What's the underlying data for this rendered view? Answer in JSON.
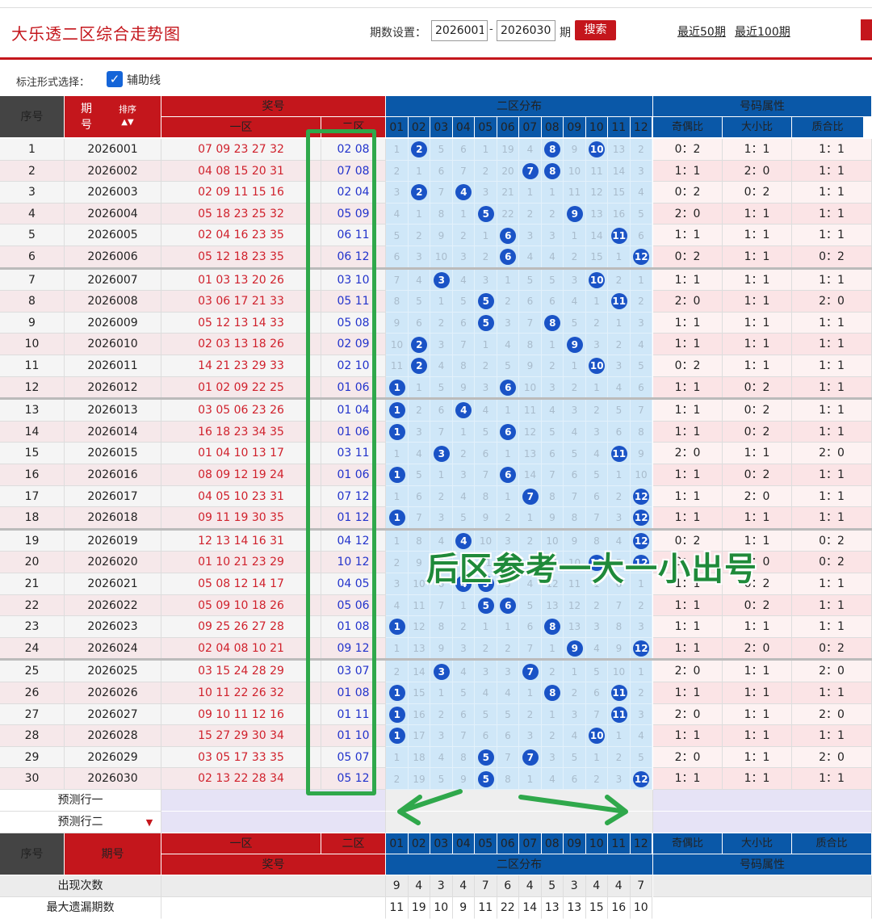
{
  "header": {
    "title": "大乐透二区综合走势图",
    "period_label": "期数设置：",
    "from_value": "2026001",
    "to_value": "2026030",
    "qi": "期",
    "search_label": "搜索",
    "recent50": "最近50期",
    "recent100": "最近100期"
  },
  "options": {
    "label": "标注形式选择：",
    "checkbox_label": "辅助线",
    "checked": true
  },
  "table_header": {
    "seq": "序号",
    "period": "期号",
    "sort": "排序",
    "prize": "奖号",
    "zone1": "一区",
    "zone2": "二区",
    "dist": "二区分布",
    "attr": "号码属性",
    "odd_even": "奇偶比",
    "big_small": "大小比",
    "prime": "质合比",
    "cols": [
      "01",
      "02",
      "03",
      "04",
      "05",
      "06",
      "07",
      "08",
      "09",
      "10",
      "11",
      "12"
    ]
  },
  "rows": [
    {
      "seq": "1",
      "period": "2026001",
      "front": "07 09 23 27 32",
      "back": "02 08",
      "dist": [
        "1",
        "02",
        "5",
        "6",
        "1",
        "19",
        "4",
        "08",
        "9",
        "10",
        "13",
        "2"
      ],
      "oe": "0：2",
      "bs": "1：1",
      "pc": "1：1"
    },
    {
      "seq": "2",
      "period": "2026002",
      "front": "04 08 15 20 31",
      "back": "07 08",
      "dist": [
        "2",
        "1",
        "6",
        "7",
        "2",
        "20",
        "07",
        "08",
        "10",
        "11",
        "14",
        "3"
      ],
      "oe": "1：1",
      "bs": "2：0",
      "pc": "1：1"
    },
    {
      "seq": "3",
      "period": "2026003",
      "front": "02 09 11 15 16",
      "back": "02 04",
      "dist": [
        "3",
        "02",
        "7",
        "04",
        "3",
        "21",
        "1",
        "1",
        "11",
        "12",
        "15",
        "4"
      ],
      "oe": "0：2",
      "bs": "0：2",
      "pc": "1：1"
    },
    {
      "seq": "4",
      "period": "2026004",
      "front": "05 18 23 25 32",
      "back": "05 09",
      "dist": [
        "4",
        "1",
        "8",
        "1",
        "05",
        "22",
        "2",
        "2",
        "09",
        "13",
        "16",
        "5"
      ],
      "oe": "2：0",
      "bs": "1：1",
      "pc": "1：1"
    },
    {
      "seq": "5",
      "period": "2026005",
      "front": "02 04 16 23 35",
      "back": "06 11",
      "dist": [
        "5",
        "2",
        "9",
        "2",
        "1",
        "06",
        "3",
        "3",
        "1",
        "14",
        "11",
        "6"
      ],
      "oe": "1：1",
      "bs": "1：1",
      "pc": "1：1"
    },
    {
      "seq": "6",
      "period": "2026006",
      "front": "05 12 18 23 35",
      "back": "06 12",
      "dist": [
        "6",
        "3",
        "10",
        "3",
        "2",
        "06",
        "4",
        "4",
        "2",
        "15",
        "1",
        "12"
      ],
      "oe": "0：2",
      "bs": "1：1",
      "pc": "0：2"
    },
    {
      "seq": "7",
      "period": "2026007",
      "front": "01 03 13 20 26",
      "back": "03 10",
      "dist": [
        "7",
        "4",
        "03",
        "4",
        "3",
        "1",
        "5",
        "5",
        "3",
        "10",
        "2",
        "1"
      ],
      "oe": "1：1",
      "bs": "1：1",
      "pc": "1：1"
    },
    {
      "seq": "8",
      "period": "2026008",
      "front": "03 06 17 21 33",
      "back": "05 11",
      "dist": [
        "8",
        "5",
        "1",
        "5",
        "05",
        "2",
        "6",
        "6",
        "4",
        "1",
        "11",
        "2"
      ],
      "oe": "2：0",
      "bs": "1：1",
      "pc": "2：0"
    },
    {
      "seq": "9",
      "period": "2026009",
      "front": "05 12 13 14 33",
      "back": "05 08",
      "dist": [
        "9",
        "6",
        "2",
        "6",
        "05",
        "3",
        "7",
        "08",
        "5",
        "2",
        "1",
        "3"
      ],
      "oe": "1：1",
      "bs": "1：1",
      "pc": "1：1"
    },
    {
      "seq": "10",
      "period": "2026010",
      "front": "02 03 13 18 26",
      "back": "02 09",
      "dist": [
        "10",
        "02",
        "3",
        "7",
        "1",
        "4",
        "8",
        "1",
        "09",
        "3",
        "2",
        "4"
      ],
      "oe": "1：1",
      "bs": "1：1",
      "pc": "1：1"
    },
    {
      "seq": "11",
      "period": "2026011",
      "front": "14 21 23 29 33",
      "back": "02 10",
      "dist": [
        "11",
        "02",
        "4",
        "8",
        "2",
        "5",
        "9",
        "2",
        "1",
        "10",
        "3",
        "5"
      ],
      "oe": "0：2",
      "bs": "1：1",
      "pc": "1：1"
    },
    {
      "seq": "12",
      "period": "2026012",
      "front": "01 02 09 22 25",
      "back": "01 06",
      "dist": [
        "01",
        "1",
        "5",
        "9",
        "3",
        "06",
        "10",
        "3",
        "2",
        "1",
        "4",
        "6"
      ],
      "oe": "1：1",
      "bs": "0：2",
      "pc": "1：1"
    },
    {
      "seq": "13",
      "period": "2026013",
      "front": "03 05 06 23 26",
      "back": "01 04",
      "dist": [
        "01",
        "2",
        "6",
        "04",
        "4",
        "1",
        "11",
        "4",
        "3",
        "2",
        "5",
        "7"
      ],
      "oe": "1：1",
      "bs": "0：2",
      "pc": "1：1"
    },
    {
      "seq": "14",
      "period": "2026014",
      "front": "16 18 23 34 35",
      "back": "01 06",
      "dist": [
        "01",
        "3",
        "7",
        "1",
        "5",
        "06",
        "12",
        "5",
        "4",
        "3",
        "6",
        "8"
      ],
      "oe": "1：1",
      "bs": "0：2",
      "pc": "1：1"
    },
    {
      "seq": "15",
      "period": "2026015",
      "front": "01 04 10 13 17",
      "back": "03 11",
      "dist": [
        "1",
        "4",
        "03",
        "2",
        "6",
        "1",
        "13",
        "6",
        "5",
        "4",
        "11",
        "9"
      ],
      "oe": "2：0",
      "bs": "1：1",
      "pc": "2：0"
    },
    {
      "seq": "16",
      "period": "2026016",
      "front": "08 09 12 19 24",
      "back": "01 06",
      "dist": [
        "01",
        "5",
        "1",
        "3",
        "7",
        "06",
        "14",
        "7",
        "6",
        "5",
        "1",
        "10"
      ],
      "oe": "1：1",
      "bs": "0：2",
      "pc": "1：1"
    },
    {
      "seq": "17",
      "period": "2026017",
      "front": "04 05 10 23 31",
      "back": "07 12",
      "dist": [
        "1",
        "6",
        "2",
        "4",
        "8",
        "1",
        "07",
        "8",
        "7",
        "6",
        "2",
        "12"
      ],
      "oe": "1：1",
      "bs": "2：0",
      "pc": "1：1"
    },
    {
      "seq": "18",
      "period": "2026018",
      "front": "09 11 19 30 35",
      "back": "01 12",
      "dist": [
        "01",
        "7",
        "3",
        "5",
        "9",
        "2",
        "1",
        "9",
        "8",
        "7",
        "3",
        "12"
      ],
      "oe": "1：1",
      "bs": "1：1",
      "pc": "1：1"
    },
    {
      "seq": "19",
      "period": "2026019",
      "front": "12 13 14 16 31",
      "back": "04 12",
      "dist": [
        "1",
        "8",
        "4",
        "04",
        "10",
        "3",
        "2",
        "10",
        "9",
        "8",
        "4",
        "12"
      ],
      "oe": "0：2",
      "bs": "1：1",
      "pc": "0：2"
    },
    {
      "seq": "20",
      "period": "2026020",
      "front": "01 10 21 23 29",
      "back": "10 12",
      "dist": [
        "2",
        "9",
        "5",
        "1",
        "11",
        "4",
        "3",
        "11",
        "10",
        "10",
        "5",
        "12"
      ],
      "oe": "0：2",
      "bs": "2：0",
      "pc": "0：2"
    },
    {
      "seq": "21",
      "period": "2026021",
      "front": "05 08 12 14 17",
      "back": "04 05",
      "dist": [
        "3",
        "10",
        "6",
        "04",
        "05",
        "5",
        "4",
        "12",
        "11",
        "1",
        "6",
        "1"
      ],
      "oe": "1：1",
      "bs": "0：2",
      "pc": "1：1"
    },
    {
      "seq": "22",
      "period": "2026022",
      "front": "05 09 10 18 26",
      "back": "05 06",
      "dist": [
        "4",
        "11",
        "7",
        "1",
        "05",
        "06",
        "5",
        "13",
        "12",
        "2",
        "7",
        "2"
      ],
      "oe": "1：1",
      "bs": "0：2",
      "pc": "1：1"
    },
    {
      "seq": "23",
      "period": "2026023",
      "front": "09 25 26 27 28",
      "back": "01 08",
      "dist": [
        "01",
        "12",
        "8",
        "2",
        "1",
        "1",
        "6",
        "08",
        "13",
        "3",
        "8",
        "3"
      ],
      "oe": "1：1",
      "bs": "1：1",
      "pc": "1：1"
    },
    {
      "seq": "24",
      "period": "2026024",
      "front": "02 04 08 10 21",
      "back": "09 12",
      "dist": [
        "1",
        "13",
        "9",
        "3",
        "2",
        "2",
        "7",
        "1",
        "09",
        "4",
        "9",
        "12"
      ],
      "oe": "1：1",
      "bs": "2：0",
      "pc": "0：2"
    },
    {
      "seq": "25",
      "period": "2026025",
      "front": "03 15 24 28 29",
      "back": "03 07",
      "dist": [
        "2",
        "14",
        "03",
        "4",
        "3",
        "3",
        "07",
        "2",
        "1",
        "5",
        "10",
        "1"
      ],
      "oe": "2：0",
      "bs": "1：1",
      "pc": "2：0"
    },
    {
      "seq": "26",
      "period": "2026026",
      "front": "10 11 22 26 32",
      "back": "01 08",
      "dist": [
        "01",
        "15",
        "1",
        "5",
        "4",
        "4",
        "1",
        "08",
        "2",
        "6",
        "11",
        "2"
      ],
      "oe": "1：1",
      "bs": "1：1",
      "pc": "1：1"
    },
    {
      "seq": "27",
      "period": "2026027",
      "front": "09 10 11 12 16",
      "back": "01 11",
      "dist": [
        "01",
        "16",
        "2",
        "6",
        "5",
        "5",
        "2",
        "1",
        "3",
        "7",
        "11",
        "3"
      ],
      "oe": "2：0",
      "bs": "1：1",
      "pc": "2：0"
    },
    {
      "seq": "28",
      "period": "2026028",
      "front": "15 27 29 30 34",
      "back": "01 10",
      "dist": [
        "01",
        "17",
        "3",
        "7",
        "6",
        "6",
        "3",
        "2",
        "4",
        "10",
        "1",
        "4"
      ],
      "oe": "1：1",
      "bs": "1：1",
      "pc": "1：1"
    },
    {
      "seq": "29",
      "period": "2026029",
      "front": "03 05 17 33 35",
      "back": "05 07",
      "dist": [
        "1",
        "18",
        "4",
        "8",
        "05",
        "7",
        "07",
        "3",
        "5",
        "1",
        "2",
        "5"
      ],
      "oe": "2：0",
      "bs": "1：1",
      "pc": "2：0"
    },
    {
      "seq": "30",
      "period": "2026030",
      "front": "02 13 22 28 34",
      "back": "05 12",
      "dist": [
        "2",
        "19",
        "5",
        "9",
        "05",
        "8",
        "1",
        "4",
        "6",
        "2",
        "3",
        "12"
      ],
      "oe": "1：1",
      "bs": "1：1",
      "pc": "1：1"
    }
  ],
  "predict": {
    "row1": "预测行一",
    "row2": "预测行二"
  },
  "stats": {
    "appear_label": "出现次数",
    "appear": [
      "9",
      "4",
      "3",
      "4",
      "7",
      "6",
      "4",
      "5",
      "3",
      "4",
      "4",
      "7"
    ],
    "maxmiss_label": "最大遗漏期数",
    "maxmiss": [
      "11",
      "19",
      "10",
      "9",
      "11",
      "22",
      "14",
      "13",
      "13",
      "15",
      "16",
      "10"
    ]
  },
  "annotation": "后区参考一大一小出号",
  "colors": {
    "red": "#c4161c",
    "blue": "#1a53c6",
    "green": "#2fa84b",
    "navy": "#0a58a8"
  }
}
